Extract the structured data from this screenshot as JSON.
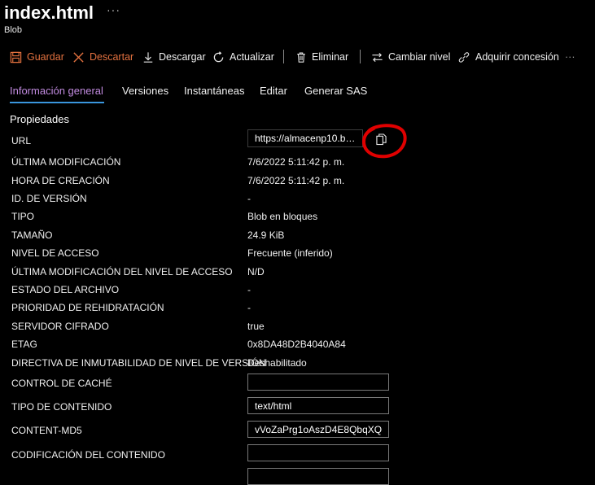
{
  "header": {
    "title": "index.html",
    "more": "···",
    "subtitle": "Blob"
  },
  "toolbar": {
    "save": "Guardar",
    "discard": "Descartar",
    "download": "Descargar",
    "refresh": "Actualizar",
    "delete": "Eliminar",
    "change_tier": "Cambiar nivel",
    "acquire_lease": "Adquirir concesión",
    "more": "···",
    "disabled_color": "#e3713f"
  },
  "tabs": {
    "overview": "Información general",
    "versions": "Versiones",
    "snapshots": "Instantáneas",
    "edit": "Editar",
    "sas": "Generar SAS",
    "active_color": "#c28be0",
    "underline_color": "#3a96dd"
  },
  "properties": {
    "section_title": "Propiedades",
    "url_label": "URL",
    "url_value": "https://almacenp10.blo...",
    "last_modified_label": "ÚLTIMA MODIFICACIÓN",
    "last_modified": "7/6/2022 5:11:42 p. m.",
    "created_label": "HORA DE CREACIÓN",
    "created": "7/6/2022 5:11:42 p. m.",
    "version_id_label": "ID. DE VERSIÓN",
    "version_id": "-",
    "type_label": "TIPO",
    "type": "Blob en bloques",
    "size_label": "TAMAÑO",
    "size": "24.9 KiB",
    "access_tier_label": "NIVEL DE ACCESO",
    "access_tier": "Frecuente (inferido)",
    "tier_modified_label": "ÚLTIMA MODIFICACIÓN DEL NIVEL DE ACCESO",
    "tier_modified": "N/D",
    "archive_status_label": "ESTADO DEL ARCHIVO",
    "archive_status": "-",
    "rehydrate_label": "PRIORIDAD DE REHIDRATACIÓN",
    "rehydrate": "-",
    "server_encrypted_label": "SERVIDOR CIFRADO",
    "server_encrypted": "true",
    "etag_label": "ETAG",
    "etag": "0x8DA48D2B4040A84",
    "immutability_label": "DIRECTIVA DE INMUTABILIDAD DE NIVEL DE VERSIÓN",
    "immutability": "Deshabilitado",
    "cache_control_label": "CONTROL DE CACHÉ",
    "cache_control": "",
    "content_type_label": "TIPO DE CONTENIDO",
    "content_type": "text/html",
    "content_md5_label": "CONTENT-MD5",
    "content_md5": "vVoZaPrg1oAszD4E8QbqXQ...",
    "content_encoding_label": "CODIFICACIÓN DEL CONTENIDO",
    "content_encoding": ""
  },
  "annotation_color": "#e00000"
}
